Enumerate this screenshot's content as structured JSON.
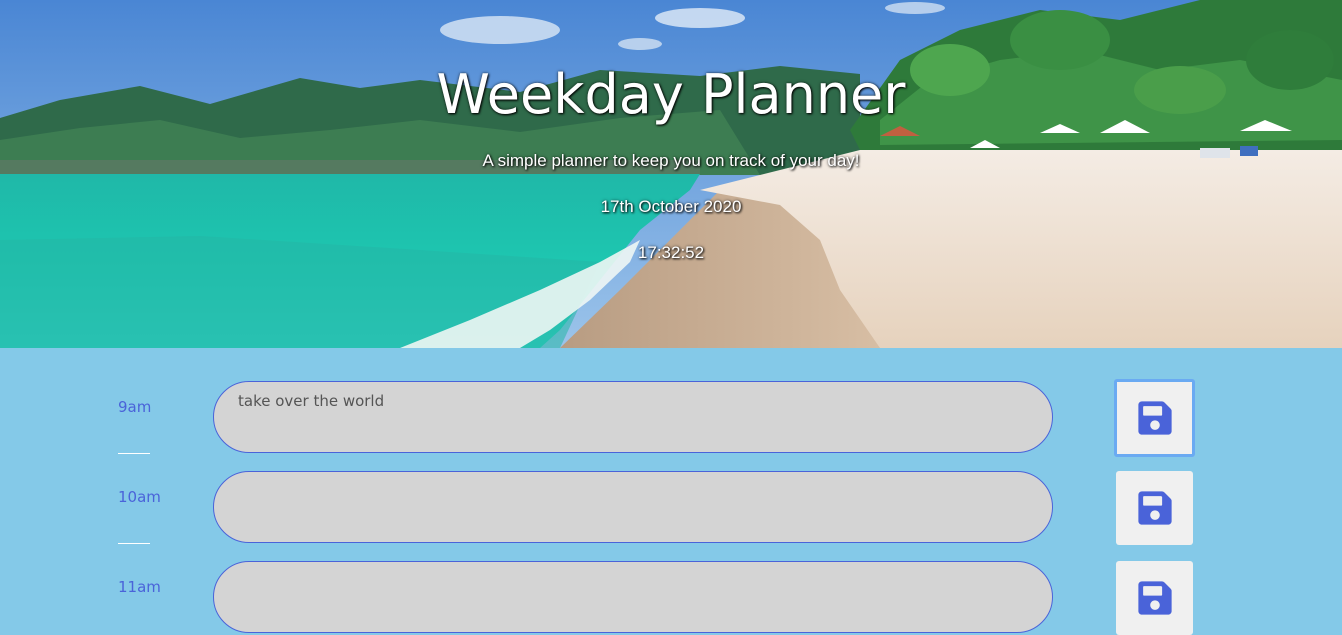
{
  "header": {
    "title": "Weekday Planner",
    "subtitle": "A simple planner to keep you on track of your day!",
    "date": "17th October 2020",
    "time": "17:32:52"
  },
  "colors": {
    "background": "#84c9e8",
    "accent": "#4a63d9",
    "textarea": "#d4d4d4",
    "save_button_bg": "#f0f0f0",
    "focus_ring": "#6aaaf2"
  },
  "rows": [
    {
      "hour": "9am",
      "task": "take over the world",
      "save_icon": "floppy-disk-icon"
    },
    {
      "hour": "10am",
      "task": "",
      "save_icon": "floppy-disk-icon"
    },
    {
      "hour": "11am",
      "task": "",
      "save_icon": "floppy-disk-icon"
    }
  ]
}
